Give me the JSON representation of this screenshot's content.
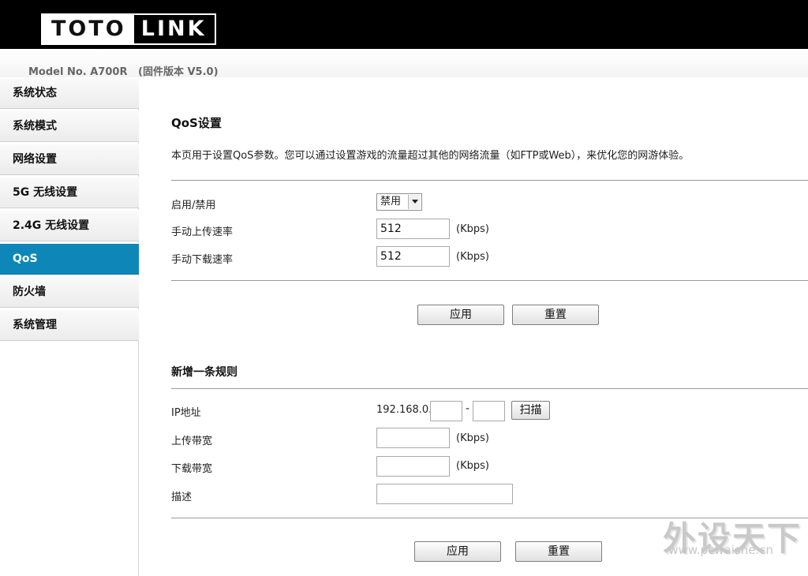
{
  "header": {
    "logo_left": "TOTO",
    "logo_right": "LINK",
    "model_line": "Model No. A700R   (固件版本 V5.0)"
  },
  "sidebar": {
    "items": [
      {
        "label": "系统状态"
      },
      {
        "label": "系统模式"
      },
      {
        "label": "网络设置"
      },
      {
        "label": "5G  无线设置"
      },
      {
        "label": "2.4G  无线设置"
      },
      {
        "label": "QoS"
      },
      {
        "label": "防火墙"
      },
      {
        "label": "系统管理"
      }
    ],
    "active": "QoS",
    "active_color": "#0e87b8"
  },
  "qos": {
    "title": "QoS设置",
    "description": "本页用于设置QoS参数。您可以通过设置游戏的流量超过其他的网络流量（如FTP或Web），来优化您的网游体验。",
    "enable_label": "启用/禁用",
    "enable_value": "禁用",
    "upload_label": "手动上传速率",
    "upload_value": "512",
    "download_label": "手动下载速率",
    "download_value": "512",
    "unit": "(Kbps)",
    "apply_label": "应用",
    "reset_label": "重置"
  },
  "rule": {
    "title": "新增一条规则",
    "ip_label": "IP地址",
    "ip_prefix": "192.168.0.",
    "ip_start": "",
    "ip_dash": "-",
    "ip_end": "",
    "scan_label": "扫描",
    "upload_label": "上传带宽",
    "upload_value": "",
    "download_label": "下载带宽",
    "download_value": "",
    "desc_label": "描述",
    "desc_value": "",
    "unit": "(Kbps)",
    "apply_label": "应用",
    "reset_label": "重置"
  },
  "watermark": {
    "text": "外设天下",
    "url": "www.pcwaishe.cn"
  }
}
